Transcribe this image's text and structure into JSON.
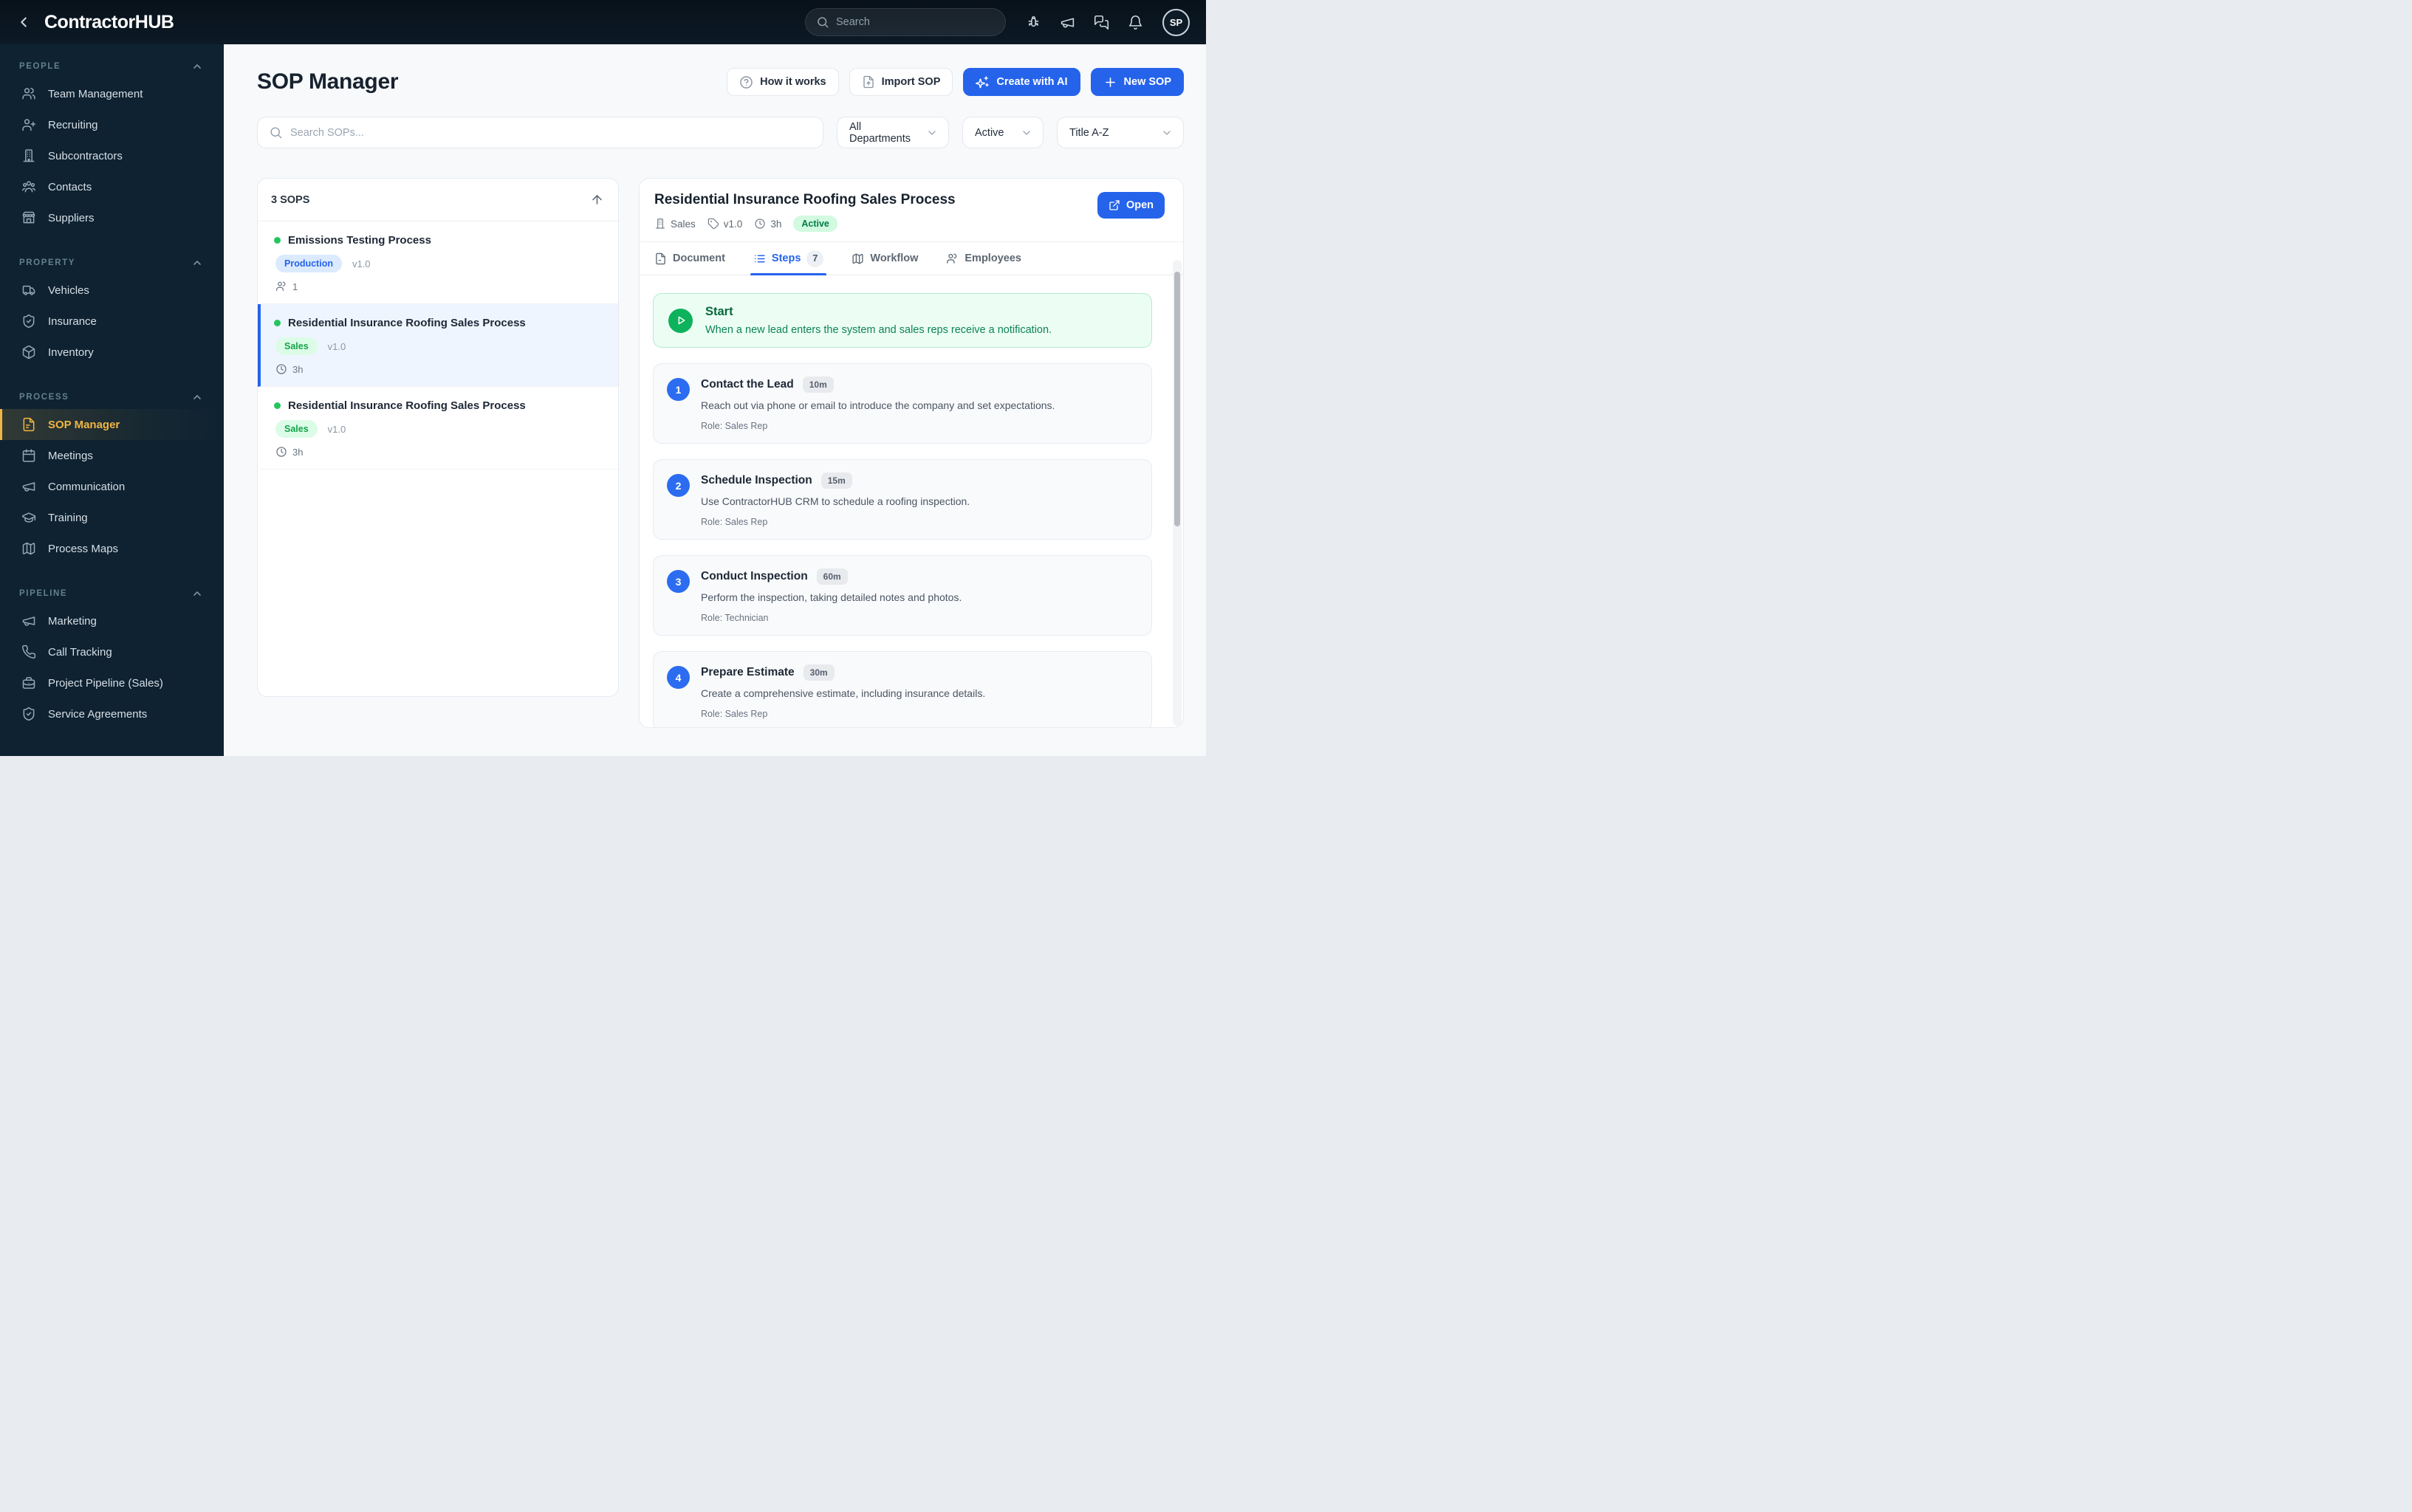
{
  "topbar": {
    "logo": "ContractorHUB",
    "search_placeholder": "Search",
    "avatar_initials": "SP"
  },
  "sidebar": {
    "sections": [
      {
        "label": "PEOPLE",
        "items": [
          {
            "label": "Team Management",
            "icon": "users-icon"
          },
          {
            "label": "Recruiting",
            "icon": "user-plus-icon"
          },
          {
            "label": "Subcontractors",
            "icon": "building-icon"
          },
          {
            "label": "Contacts",
            "icon": "contacts-icon"
          },
          {
            "label": "Suppliers",
            "icon": "store-icon"
          }
        ]
      },
      {
        "label": "PROPERTY",
        "items": [
          {
            "label": "Vehicles",
            "icon": "truck-icon"
          },
          {
            "label": "Insurance",
            "icon": "shield-check-icon"
          },
          {
            "label": "Inventory",
            "icon": "box-icon"
          }
        ]
      },
      {
        "label": "PROCESS",
        "items": [
          {
            "label": "SOP Manager",
            "icon": "document-icon",
            "active": true
          },
          {
            "label": "Meetings",
            "icon": "calendar-icon"
          },
          {
            "label": "Communication",
            "icon": "megaphone-icon"
          },
          {
            "label": "Training",
            "icon": "graduation-cap-icon"
          },
          {
            "label": "Process Maps",
            "icon": "map-icon"
          }
        ]
      },
      {
        "label": "PIPELINE",
        "items": [
          {
            "label": "Marketing",
            "icon": "megaphone-icon"
          },
          {
            "label": "Call Tracking",
            "icon": "phone-icon"
          },
          {
            "label": "Project Pipeline (Sales)",
            "icon": "briefcase-icon"
          },
          {
            "label": "Service Agreements",
            "icon": "shield-check-icon"
          }
        ]
      }
    ]
  },
  "header": {
    "title": "SOP Manager",
    "buttons": {
      "how_it_works": "How it works",
      "import_sop": "Import SOP",
      "create_with_ai": "Create with AI",
      "new_sop": "New SOP"
    }
  },
  "filters": {
    "search_placeholder": "Search SOPs...",
    "department": "All Departments",
    "status": "Active",
    "sort": "Title A-Z"
  },
  "sop_list": {
    "count_label": "3 SOPS",
    "items": [
      {
        "title": "Emissions Testing Process",
        "department": "Production",
        "version": "v1.0",
        "meta": "1",
        "meta_icon": "users-icon",
        "selected": false
      },
      {
        "title": "Residential Insurance Roofing Sales Process",
        "department": "Sales",
        "version": "v1.0",
        "meta": "3h",
        "meta_icon": "clock-icon",
        "selected": true
      },
      {
        "title": "Residential Insurance Roofing Sales Process",
        "department": "Sales",
        "version": "v1.0",
        "meta": "3h",
        "meta_icon": "clock-icon",
        "selected": false
      }
    ]
  },
  "detail": {
    "title": "Residential Insurance Roofing Sales Process",
    "department": "Sales",
    "version": "v1.0",
    "duration": "3h",
    "status": "Active",
    "open_label": "Open",
    "tabs": [
      {
        "label": "Document",
        "icon": "document-icon"
      },
      {
        "label": "Steps",
        "badge": "7",
        "icon": "list-icon",
        "active": true
      },
      {
        "label": "Workflow",
        "icon": "map-icon"
      },
      {
        "label": "Employees",
        "icon": "users-icon"
      }
    ],
    "start": {
      "title": "Start",
      "description": "When a new lead enters the system and sales reps receive a notification."
    },
    "steps": [
      {
        "num": "1",
        "title": "Contact the Lead",
        "duration": "10m",
        "description": "Reach out via phone or email to introduce the company and set expectations.",
        "role": "Role: Sales Rep"
      },
      {
        "num": "2",
        "title": "Schedule Inspection",
        "duration": "15m",
        "description": "Use ContractorHUB CRM to schedule a roofing inspection.",
        "role": "Role: Sales Rep"
      },
      {
        "num": "3",
        "title": "Conduct Inspection",
        "duration": "60m",
        "description": "Perform the inspection, taking detailed notes and photos.",
        "role": "Role: Technician"
      },
      {
        "num": "4",
        "title": "Prepare Estimate",
        "duration": "30m",
        "description": "Create a comprehensive estimate, including insurance details.",
        "role": "Role: Sales Rep"
      }
    ]
  },
  "colors": {
    "accent_blue": "#2563eb",
    "accent_amber": "#f0b643",
    "status_green": "#22c55e",
    "sidebar_bg": "#0e2231",
    "topbar_bg": "#0a1722",
    "page_bg": "#f7f9fb"
  }
}
